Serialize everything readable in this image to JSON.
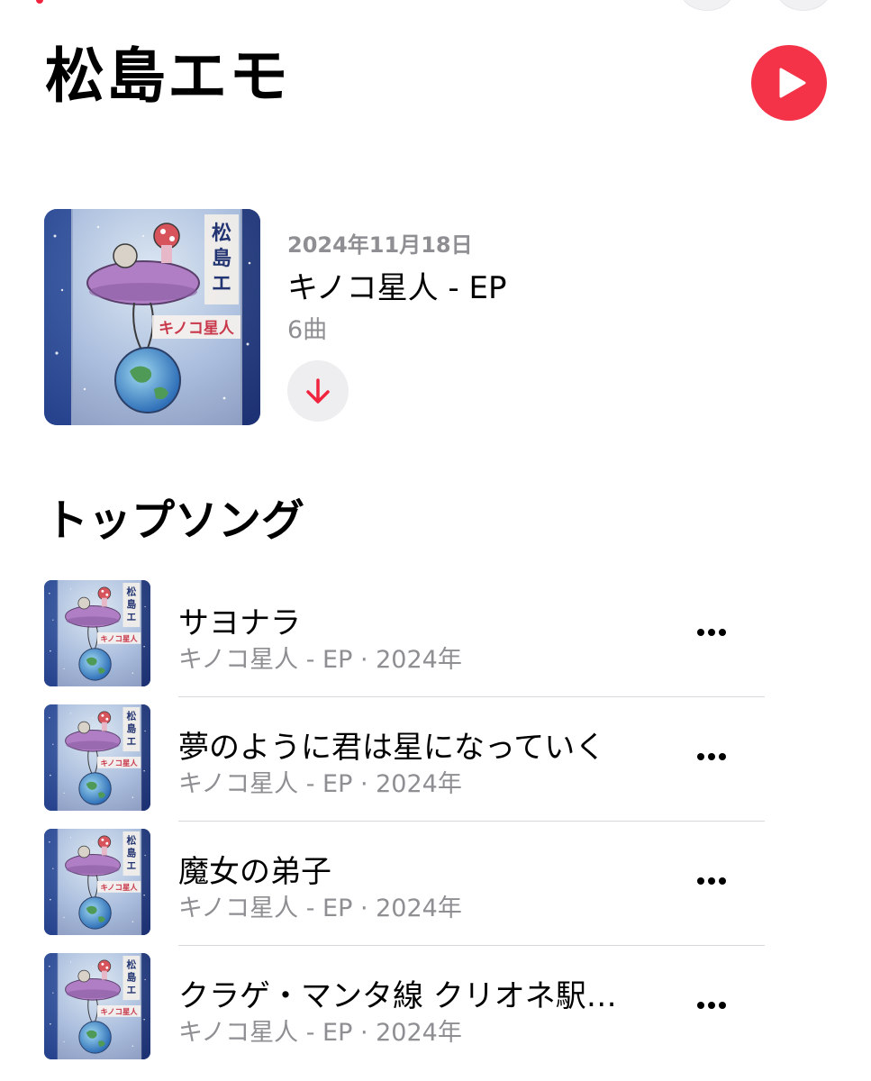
{
  "artist": {
    "name": "松島エモ"
  },
  "latest_release": {
    "date": "2024年11月18日",
    "title": "キノコ星人 - EP",
    "track_count": "6曲",
    "art_text": {
      "artist": "松島エモ",
      "album": "キノコ星人"
    }
  },
  "top_songs": {
    "title": "トップソング",
    "items": [
      {
        "title": "サヨナラ",
        "subtitle": "キノコ星人 - EP · 2024年"
      },
      {
        "title": "夢のように君は星になっていく",
        "subtitle": "キノコ星人 - EP · 2024年"
      },
      {
        "title": "魔女の弟子",
        "subtitle": "キノコ星人 - EP · 2024年"
      },
      {
        "title": "クラゲ・マンタ線 クリオネ駅…",
        "subtitle": "キノコ星人 - EP · 2024年"
      }
    ]
  },
  "colors": {
    "accent": "#f43248",
    "secondary_text": "#8e8e93",
    "download_arrow": "#f0243f"
  },
  "icons": {
    "play": "play-icon",
    "download": "download-arrow-icon",
    "more": "ellipsis-icon"
  }
}
